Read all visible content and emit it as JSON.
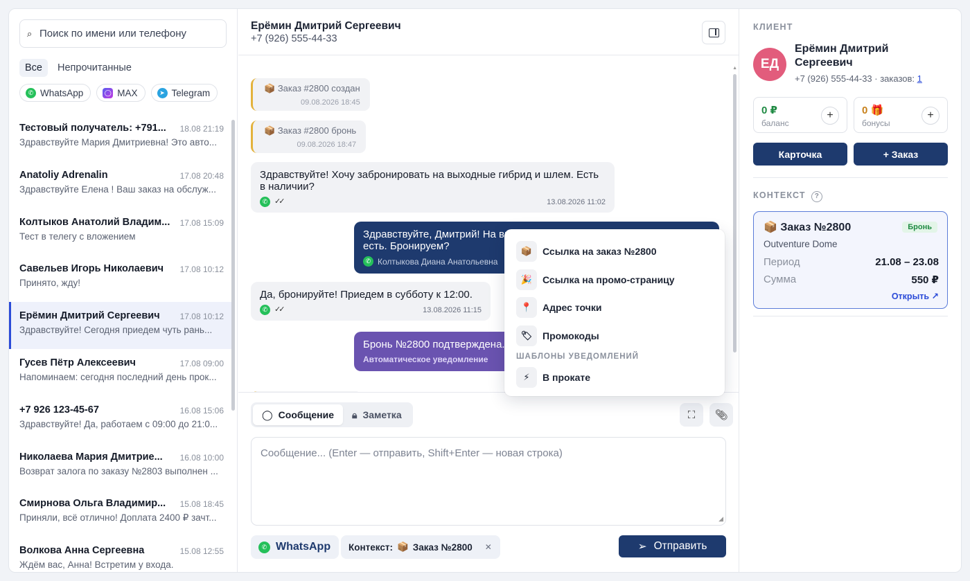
{
  "left": {
    "search_placeholder": "Поиск по имени или телефону",
    "filters": [
      "Все",
      "Непрочитанные"
    ],
    "channels": [
      {
        "label": "WhatsApp",
        "icon": "whatsapp-icon",
        "color": "#25c05a"
      },
      {
        "label": "MAX",
        "icon": "max-icon",
        "color": "#7a4ee8"
      },
      {
        "label": "Telegram",
        "icon": "telegram-icon",
        "color": "#2aa3e0"
      }
    ],
    "conversations": [
      {
        "name": "Тестовый получатель: +791...",
        "time": "18.08 21:19",
        "preview": "Здравствуйте Мария Дмитриевна! Это авто..."
      },
      {
        "name": "Anatoliy Adrenalin",
        "time": "17.08 20:48",
        "preview": "Здравствуйте Елена ! Ваш заказ на обслуж..."
      },
      {
        "name": "Колтыков Анатолий Владим...",
        "time": "17.08 15:09",
        "preview": "Тест в телегу с вложением"
      },
      {
        "name": "Савельев Игорь Николаевич",
        "time": "17.08 10:12",
        "preview": "Принято, жду!"
      },
      {
        "name": "Ерёмин Дмитрий Сергеевич",
        "time": "17.08 10:12",
        "preview": "Здравствуйте! Сегодня приедем чуть рань..."
      },
      {
        "name": "Гусев Пётр Алексеевич",
        "time": "17.08 09:00",
        "preview": "Напоминаем: сегодня последний день прок..."
      },
      {
        "name": "+7 926 123-45-67",
        "time": "16.08 15:06",
        "preview": "Здравствуйте! Да, работаем с 09:00 до 21:0..."
      },
      {
        "name": "Николаева Мария Дмитрие...",
        "time": "16.08 10:00",
        "preview": "Возврат залога по заказу №2803 выполнен ..."
      },
      {
        "name": "Смирнова Ольга Владимир...",
        "time": "15.08 18:45",
        "preview": "Приняли, всё отлично! Доплата 2400 ₽ зачт..."
      },
      {
        "name": "Волкова Анна Сергеевна",
        "time": "15.08 12:55",
        "preview": "Ждём вас, Анна! Встретим у входа."
      }
    ]
  },
  "chat": {
    "name": "Ерёмин Дмитрий Сергеевич",
    "phone": "+7 (926) 555-44-33",
    "messages": {
      "sys1": {
        "text": "Заказ #2800 создан",
        "time": "09.08.2026 18:45"
      },
      "sys2": {
        "text": "Заказ #2800 бронь",
        "time": "09.08.2026 18:47"
      },
      "in1": {
        "text": "Здравствуйте! Хочу забронировать на выходные гибрид и шлем. Есть в наличии?",
        "time": "13.08.2026 11:02"
      },
      "out1": {
        "text": "Здравствуйте, Дмитрий! На выходные свободны 3 гибрида, шлемы есть. Бронируем?",
        "author": "Колтыкова Диана Анатольевна"
      },
      "in2": {
        "text": "Да, бронируйте! Приедем в субботу к 12:00.",
        "time": "13.08.2026 11:15"
      },
      "auto1": {
        "text": "Бронь №2800 подтверждена. Не забудьте паспорт!",
        "label": "Автоматическое уведомление"
      }
    },
    "composer": {
      "tab_message": "Сообщение",
      "tab_note": "Заметка",
      "placeholder": "Сообщение... (Enter — отправить, Shift+Enter — новая строка)",
      "channel": "WhatsApp",
      "context_label": "Контекст:",
      "context_value": "Заказ №2800",
      "send": "Отправить"
    },
    "popup": {
      "items": [
        {
          "label": "Ссылка на заказ №2800",
          "icon": "📦"
        },
        {
          "label": "Ссылка на промо-страницу",
          "icon": "🎉"
        },
        {
          "label": "Адрес точки",
          "icon": "📍"
        },
        {
          "label": "Промокоды",
          "icon": "🏷"
        }
      ],
      "templates_header": "ШАБЛОНЫ УВЕДОМЛЕНИЙ",
      "templates": [
        {
          "label": "В прокате",
          "icon": "⚡"
        }
      ]
    }
  },
  "client": {
    "section": "КЛИЕНТ",
    "initials": "ЕД",
    "name": "Ерёмин Дмитрий Сергеевич",
    "meta_prefix": "+7 (926) 555-44-33 · заказов:",
    "orders_count": "1",
    "balance_value": "0 ₽",
    "balance_label": "баланс",
    "bonus_value": "0 🎁",
    "bonus_label": "бонусы",
    "card_button": "Карточка",
    "order_button": "+ Заказ",
    "context_section": "КОНТЕКСТ",
    "context_card": {
      "title": "Заказ №2800",
      "badge": "Бронь",
      "location": "Outventure Dome",
      "period_label": "Период",
      "period_value": "21.08 – 23.08",
      "sum_label": "Сумма",
      "sum_value": "550 ₽",
      "open": "Открыть ↗"
    }
  }
}
